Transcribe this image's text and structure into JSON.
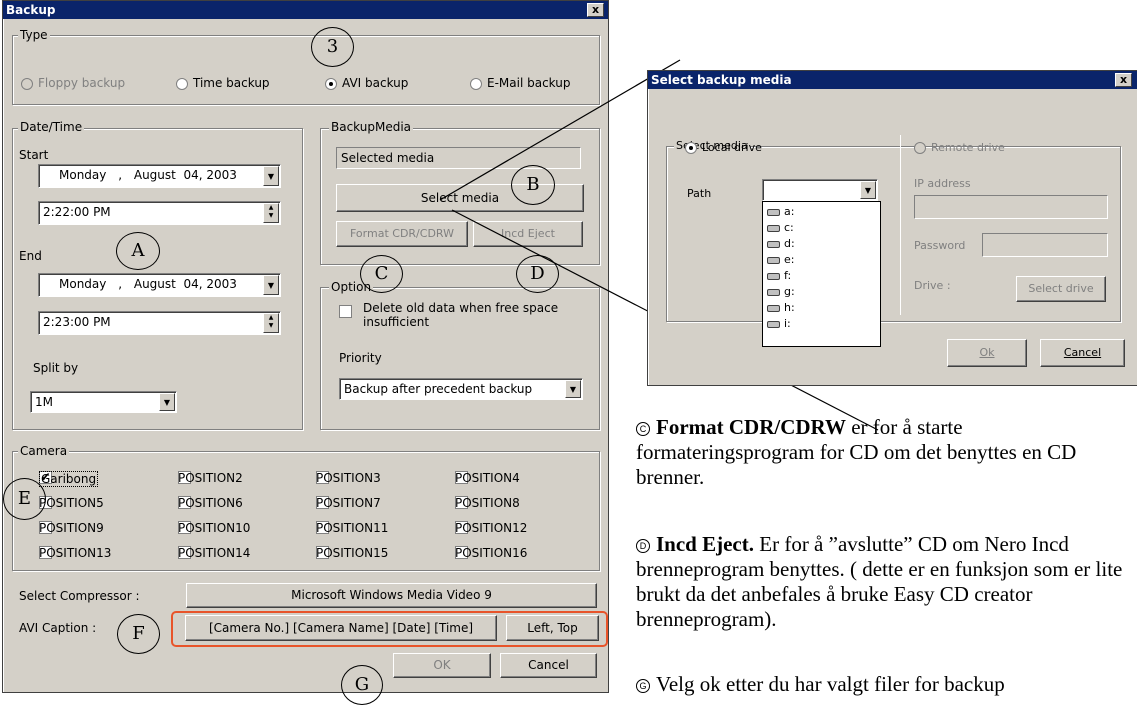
{
  "backup_window": {
    "title": "Backup",
    "close_label": "x",
    "type_group": {
      "label": "Type",
      "options": [
        {
          "label": "Floppy backup",
          "selected": false,
          "disabled": true
        },
        {
          "label": "Time backup",
          "selected": false,
          "disabled": false
        },
        {
          "label": "AVI backup",
          "selected": true,
          "disabled": false
        },
        {
          "label": "E-Mail backup",
          "selected": false,
          "disabled": false
        }
      ]
    },
    "datetime": {
      "label": "Date/Time",
      "start_label": "Start",
      "start_date_day": "Monday",
      "start_date_sep": ",",
      "start_date_rest": "August  04, 2003",
      "start_time": "2:22:00 PM",
      "end_label": "End",
      "end_date_day": "Monday",
      "end_date_sep": ",",
      "end_date_rest": "August  04, 2003",
      "end_time": "2:23:00 PM",
      "split_label": "Split by",
      "split_value": "1M"
    },
    "backup_media": {
      "label": "BackupMedia",
      "selected_media": "Selected media",
      "select_media_button": "Select media",
      "format_button": "Format CDR/CDRW",
      "eject_button": "Incd Eject"
    },
    "option": {
      "label": "Option",
      "delete_old": "Delete old data when free space insufficient",
      "priority_label": "Priority",
      "priority_value": "Backup after precedent backup"
    },
    "camera": {
      "label": "Camera",
      "items": [
        {
          "label": "Garibong",
          "checked": true
        },
        {
          "label": "POSITION2",
          "checked": false
        },
        {
          "label": "POSITION3",
          "checked": false
        },
        {
          "label": "POSITION4",
          "checked": false
        },
        {
          "label": "POSITION5",
          "checked": false
        },
        {
          "label": "POSITION6",
          "checked": false
        },
        {
          "label": "POSITION7",
          "checked": false
        },
        {
          "label": "POSITION8",
          "checked": false
        },
        {
          "label": "POSITION9",
          "checked": false
        },
        {
          "label": "POSITION10",
          "checked": false
        },
        {
          "label": "POSITION11",
          "checked": false
        },
        {
          "label": "POSITION12",
          "checked": false
        },
        {
          "label": "POSITION13",
          "checked": false
        },
        {
          "label": "POSITION14",
          "checked": false
        },
        {
          "label": "POSITION15",
          "checked": false
        },
        {
          "label": "POSITION16",
          "checked": false
        }
      ]
    },
    "compressor_label": "Select Compressor :",
    "compressor_value": "Microsoft Windows Media Video 9",
    "caption_label": "AVI Caption :",
    "caption_value": "[Camera No.] [Camera Name] [Date] [Time]",
    "caption_position": "Left, Top",
    "ok_button": "OK",
    "cancel_button": "Cancel"
  },
  "markers": {
    "m3": "3",
    "A": "A",
    "B": "B",
    "C": "C",
    "D": "D",
    "E": "E",
    "F": "F",
    "G": "G"
  },
  "media_window": {
    "title": "Select backup media",
    "close_label": "x",
    "group_label": "Select media",
    "local_drive": "Local drive",
    "remote_drive": "Remote drive",
    "path_label": "Path",
    "ip_label": "IP address",
    "password_label": "Password",
    "drive_label": "Drive :",
    "select_drive_button": "Select drive",
    "drives": [
      "a:",
      "c:",
      "d:",
      "e:",
      "f:",
      "g:",
      "h:",
      "i:"
    ],
    "ok_button": "Ok",
    "cancel_button": "Cancel"
  },
  "doc_text": {
    "c_marker": "C",
    "c_bold": "Format CDR/CDRW",
    "c_text": " er for å starte formateringsprogram for CD om det benyttes en CD brenner.",
    "d_marker": "D",
    "d_bold": "Incd Eject.",
    "d_text": " Er for å ”avslutte” CD om Nero Incd brenneprogram benyttes. ( dette er en funksjon som er lite brukt da det anbefales å bruke Easy CD creator brenneprogram).",
    "g_marker": "G",
    "g_text": "Velg ok etter du har valgt filer for backup"
  }
}
